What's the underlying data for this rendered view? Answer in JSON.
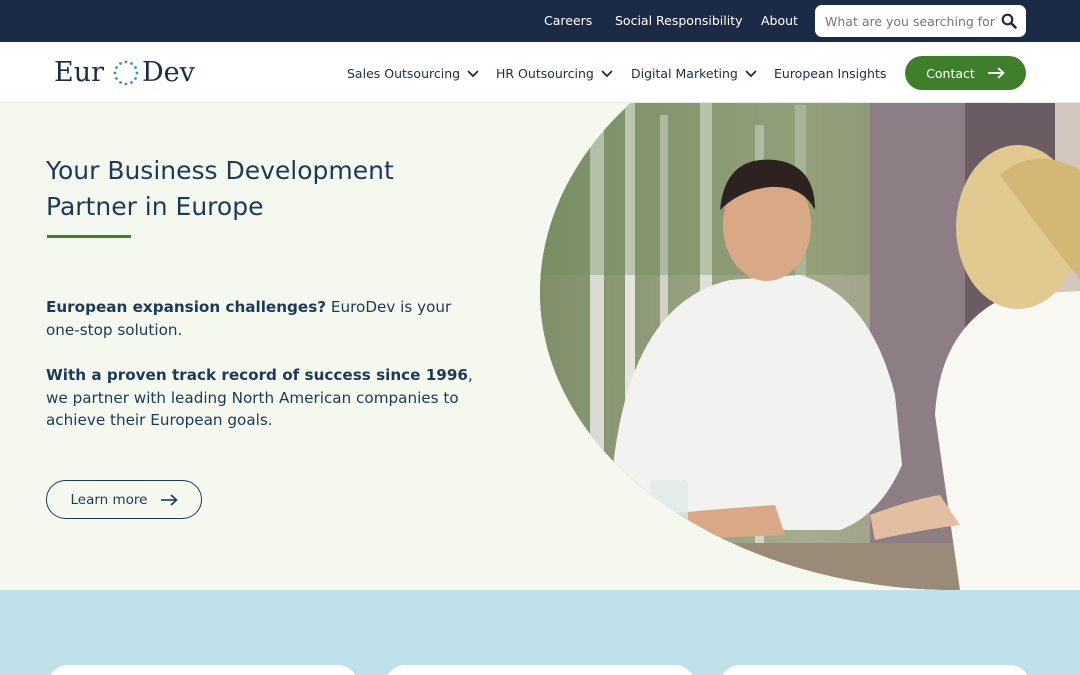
{
  "topbar": {
    "links": [
      "Careers",
      "Social Responsibility",
      "About"
    ],
    "search_placeholder": "What are you searching for?"
  },
  "logo": {
    "part1": "Eur",
    "part2": "Dev"
  },
  "nav": {
    "items": [
      "Sales Outsourcing",
      "HR Outsourcing",
      "Digital Marketing",
      "European Insights"
    ],
    "contact_label": "Contact"
  },
  "hero": {
    "title": "Your Business Development Partner in Europe",
    "p1_bold": "European expansion challenges?",
    "p1_rest": " EuroDev is your one-stop solution.",
    "p2_bold": "With a proven track record of success since 1996",
    "p2_rest": ", we partner with leading North American companies to achieve their European goals.",
    "cta_label": "Learn more"
  },
  "colors": {
    "topbar": "#1b2b47",
    "brand_green": "#3f7f2c",
    "hero_bg": "#f5f8ef",
    "band_bg": "#bfe1ec",
    "text": "#1c3a57"
  },
  "icons": {
    "search": "search-icon",
    "chevron": "chevron-down-icon",
    "arrow": "arrow-right-icon"
  }
}
